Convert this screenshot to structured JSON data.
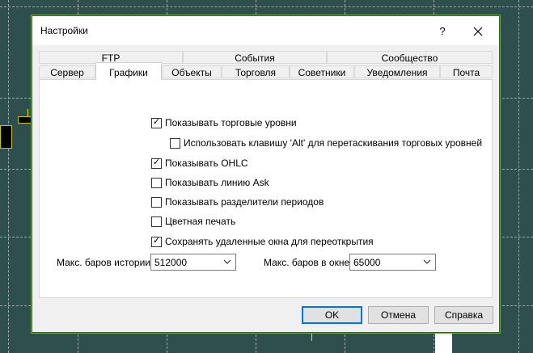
{
  "dialog": {
    "title": "Настройки",
    "help_label": "?",
    "close_label": "✕"
  },
  "tabs": {
    "row1": [
      {
        "label": "FTP"
      },
      {
        "label": "События"
      },
      {
        "label": "Сообщество"
      }
    ],
    "row2": [
      {
        "label": "Сервер"
      },
      {
        "label": "Графики",
        "active": true
      },
      {
        "label": "Объекты"
      },
      {
        "label": "Торговля"
      },
      {
        "label": "Советники"
      },
      {
        "label": "Уведомления"
      },
      {
        "label": "Почта"
      }
    ]
  },
  "options": [
    {
      "label": "Показывать торговые уровни",
      "checked": true
    },
    {
      "label": "Использовать клавишу 'Alt' для перетаскивания торговых уровней",
      "checked": false
    },
    {
      "label": "Показывать OHLC",
      "checked": true
    },
    {
      "label": "Показывать линию Ask",
      "checked": false
    },
    {
      "label": "Показывать разделители периодов",
      "checked": false
    },
    {
      "label": "Цветная печать",
      "checked": false
    },
    {
      "label": "Сохранять удаленные окна для переоткрытия",
      "checked": true
    }
  ],
  "fields": {
    "max_bars_history": {
      "label": "Макс. баров истории:",
      "value": "512000"
    },
    "max_bars_window": {
      "label": "Макс. баров в окне:",
      "value": "65000"
    }
  },
  "buttons": {
    "ok": "OK",
    "cancel": "Отмена",
    "help": "Справка"
  },
  "colors": {
    "chart_background": "#2f4f4f",
    "accent": "#0078d7"
  }
}
